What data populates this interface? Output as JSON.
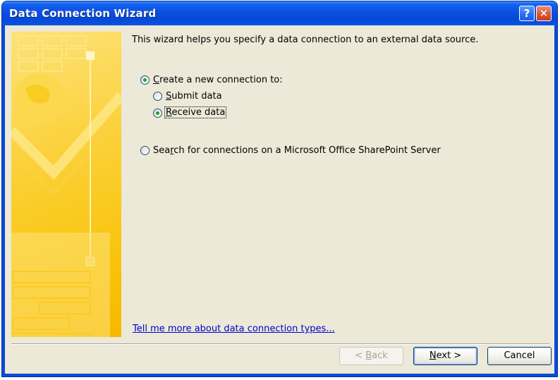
{
  "window": {
    "title": "Data Connection Wizard",
    "help_glyph": "?",
    "close_glyph": "✕"
  },
  "intro": "This wizard helps you specify a data connection to an external data source.",
  "options": {
    "create_new": {
      "prefix": "",
      "accel": "C",
      "rest": "reate a new connection to:",
      "checked": true
    },
    "submit": {
      "accel": "S",
      "rest": "ubmit data",
      "checked": false
    },
    "receive": {
      "accel": "R",
      "rest": "eceive data",
      "checked": true
    },
    "search": {
      "prefix": "Sea",
      "accel": "r",
      "rest": "ch for connections on a Microsoft Office SharePoint Server",
      "checked": false
    }
  },
  "link": {
    "accel": "T",
    "rest": "ell me more about data connection types..."
  },
  "buttons": {
    "back": {
      "prefix": "< ",
      "accel": "B",
      "rest": "ack"
    },
    "next": {
      "accel": "N",
      "rest": "ext >"
    },
    "cancel": "Cancel"
  },
  "colors": {
    "title_bar": "#0a50e0",
    "client_bg": "#ece9d8",
    "side_panel": "#f9c40c",
    "radio_dot": "#21a121",
    "link": "#0000cc"
  }
}
